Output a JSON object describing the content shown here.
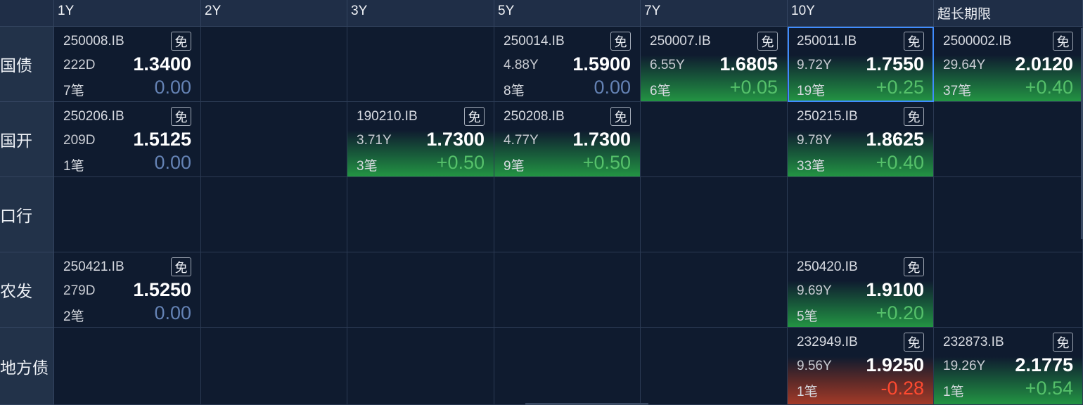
{
  "columns": [
    "1Y",
    "2Y",
    "3Y",
    "5Y",
    "7Y",
    "10Y",
    "超长期限"
  ],
  "rows": [
    {
      "label": "国债",
      "cells": [
        {
          "code": "250008.IB",
          "badge": "免",
          "term": "222D",
          "price": "1.3400",
          "count": "7笔",
          "change": "0.00",
          "trend": "zero"
        },
        null,
        null,
        {
          "code": "250014.IB",
          "badge": "免",
          "term": "4.88Y",
          "price": "1.5900",
          "count": "8笔",
          "change": "0.00",
          "trend": "zero"
        },
        {
          "code": "250007.IB",
          "badge": "免",
          "term": "6.55Y",
          "price": "1.6805",
          "count": "6笔",
          "change": "+0.05",
          "trend": "up"
        },
        {
          "code": "250011.IB",
          "badge": "免",
          "term": "9.72Y",
          "price": "1.7550",
          "count": "19笔",
          "change": "+0.25",
          "trend": "up",
          "selected": true
        },
        {
          "code": "2500002.IB",
          "badge": "免",
          "term": "29.64Y",
          "price": "2.0120",
          "count": "37笔",
          "change": "+0.40",
          "trend": "up"
        }
      ]
    },
    {
      "label": "国开",
      "cells": [
        {
          "code": "250206.IB",
          "badge": "免",
          "term": "209D",
          "price": "1.5125",
          "count": "1笔",
          "change": "0.00",
          "trend": "zero"
        },
        null,
        {
          "code": "190210.IB",
          "badge": "免",
          "term": "3.71Y",
          "price": "1.7300",
          "count": "3笔",
          "change": "+0.50",
          "trend": "up"
        },
        {
          "code": "250208.IB",
          "badge": "免",
          "term": "4.77Y",
          "price": "1.7300",
          "count": "9笔",
          "change": "+0.50",
          "trend": "up"
        },
        null,
        {
          "code": "250215.IB",
          "badge": "免",
          "term": "9.78Y",
          "price": "1.8625",
          "count": "33笔",
          "change": "+0.40",
          "trend": "up"
        },
        null
      ]
    },
    {
      "label": "口行",
      "cells": [
        null,
        null,
        null,
        null,
        null,
        null,
        null
      ]
    },
    {
      "label": "农发",
      "cells": [
        {
          "code": "250421.IB",
          "badge": "免",
          "term": "279D",
          "price": "1.5250",
          "count": "2笔",
          "change": "0.00",
          "trend": "zero"
        },
        null,
        null,
        null,
        null,
        {
          "code": "250420.IB",
          "badge": "免",
          "term": "9.69Y",
          "price": "1.9100",
          "count": "5笔",
          "change": "+0.20",
          "trend": "up"
        },
        null
      ]
    },
    {
      "label": "地方债",
      "cells": [
        null,
        null,
        null,
        null,
        null,
        {
          "code": "232949.IB",
          "badge": "免",
          "term": "9.56Y",
          "price": "1.9250",
          "count": "1笔",
          "change": "-0.28",
          "trend": "down"
        },
        {
          "code": "232873.IB",
          "badge": "免",
          "term": "19.26Y",
          "price": "2.1775",
          "count": "1笔",
          "change": "+0.54",
          "trend": "up"
        }
      ]
    }
  ],
  "colors": {
    "background": "#0e1a2f",
    "header": "#1f2e47",
    "up_gradient": "#239443",
    "down_gradient": "#a33a28",
    "up_text": "#55c16a",
    "down_text": "#ff4a30",
    "zero_text": "#6482b4",
    "selection": "#3f8cff"
  }
}
